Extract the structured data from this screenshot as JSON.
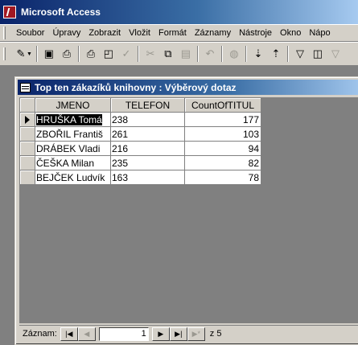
{
  "app": {
    "title": "Microsoft Access"
  },
  "menu": [
    "Soubor",
    "Úpravy",
    "Zobrazit",
    "Vložit",
    "Formát",
    "Záznamy",
    "Nástroje",
    "Okno",
    "Nápo"
  ],
  "toolbar": {
    "icons": [
      "design-view-icon",
      "save-icon",
      "print-preview-icon",
      "print-icon",
      "preview-icon",
      "spelling-icon",
      "cut-icon",
      "copy-icon",
      "paste-icon",
      "undo-icon",
      "hyperlink-icon",
      "sort-ascending-icon",
      "sort-descending-icon",
      "filter-by-selection-icon",
      "filter-by-form-icon",
      "apply-filter-icon"
    ]
  },
  "query_window": {
    "title": "Top ten zákazíků knihovny : Výběrový dotaz",
    "columns": [
      "JMENO",
      "TELEFON",
      "CountOfTITUL"
    ],
    "rows": [
      {
        "jmeno": "HRUŠKA Tomá",
        "telefon": "238",
        "count": "177"
      },
      {
        "jmeno": "ZBOŘIL Františ",
        "telefon": "261",
        "count": "103"
      },
      {
        "jmeno": "DRÁBEK Vladi",
        "telefon": "216",
        "count": "94"
      },
      {
        "jmeno": "ČEŠKA Milan",
        "telefon": "235",
        "count": "82"
      },
      {
        "jmeno": "BEJČEK Ludvík",
        "telefon": "163",
        "count": "78"
      }
    ]
  },
  "navigation": {
    "label": "Záznam:",
    "current": "1",
    "of_text": "z 5"
  }
}
